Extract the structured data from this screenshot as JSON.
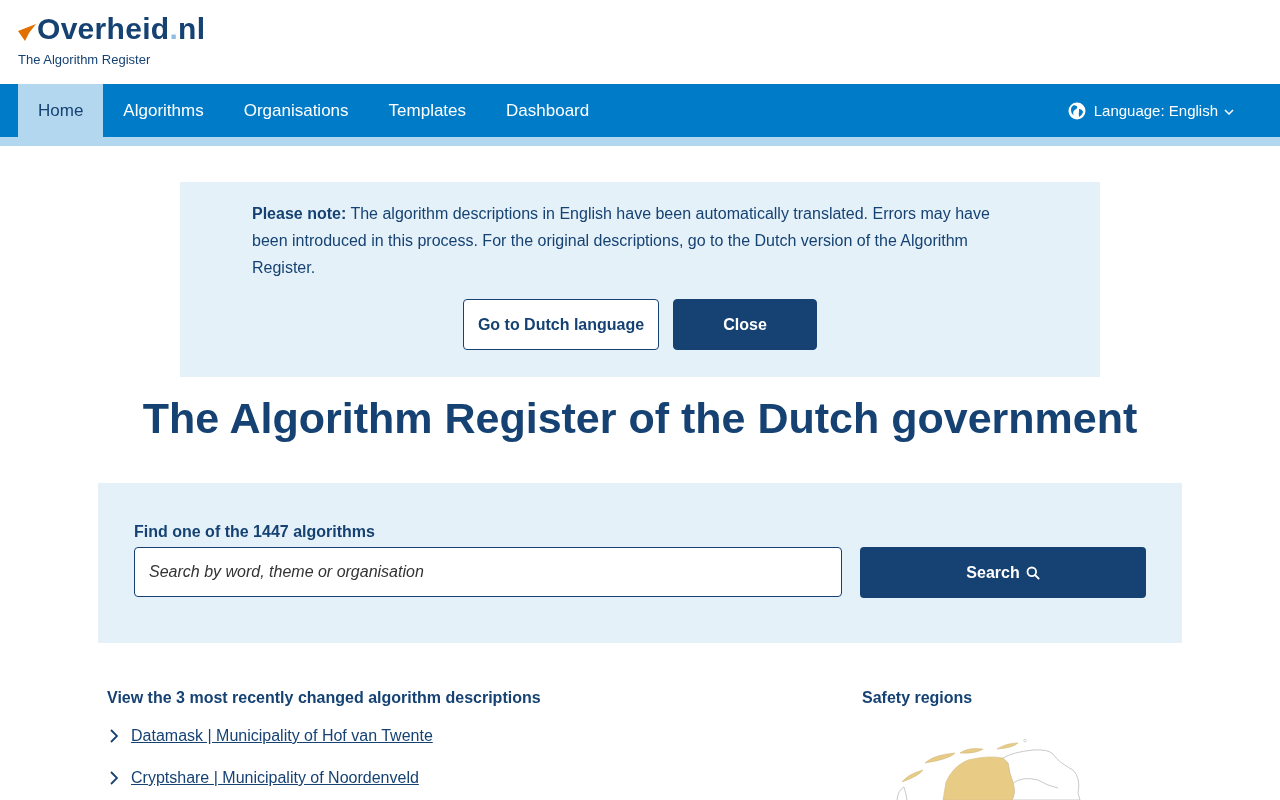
{
  "header": {
    "logo": {
      "parts": [
        {
          "text": "Overheid",
          "kind": "name"
        },
        {
          "text": ".",
          "kind": "dot"
        },
        {
          "text": "nl",
          "kind": "name"
        }
      ]
    },
    "subtitle": "The Algorithm Register"
  },
  "nav": {
    "items": [
      {
        "label": "Home",
        "selected": true
      },
      {
        "label": "Algorithms",
        "selected": false
      },
      {
        "label": "Organisations",
        "selected": false
      },
      {
        "label": "Templates",
        "selected": false
      },
      {
        "label": "Dashboard",
        "selected": false
      }
    ],
    "language": {
      "label": "Language: English"
    }
  },
  "notice": {
    "text": "**Please note:** The algorithm descriptions in English have been automatically translated. Errors may have been introduced in this process. For the original descriptions, go to the Dutch version of the Algorithm Register.",
    "buttons": [
      {
        "label": "Go to Dutch language",
        "kind": "secondary"
      },
      {
        "label": "Close",
        "kind": "primary"
      }
    ]
  },
  "title": "The Algorithm Register of the Dutch government",
  "search": {
    "label": "Find one of the 1447 algorithms",
    "placeholder": "Search by word, theme or organisation",
    "button": "Search"
  },
  "recent": {
    "heading": "View the 3 most recently changed algorithm descriptions",
    "links": [
      "Datamask | Municipality of Hof van Twente",
      "Cryptshare | Municipality of Noordenveld"
    ]
  },
  "map": {
    "heading": "Safety regions"
  }
}
